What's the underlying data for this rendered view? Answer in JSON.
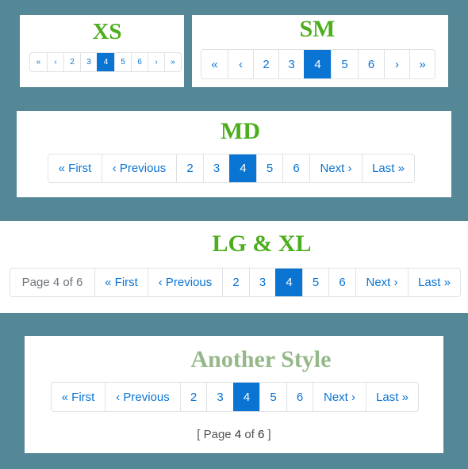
{
  "xs": {
    "heading": "XS",
    "items": [
      "«",
      "‹",
      "2",
      "3",
      "4",
      "5",
      "6",
      "›",
      "»"
    ],
    "active": 4
  },
  "sm": {
    "heading": "SM",
    "items": [
      "«",
      "‹",
      "2",
      "3",
      "4",
      "5",
      "6",
      "›",
      "»"
    ],
    "active": 4
  },
  "md": {
    "heading": "MD",
    "items": [
      "« First",
      "‹ Previous",
      "2",
      "3",
      "4",
      "5",
      "6",
      "Next ›",
      "Last »"
    ],
    "active": 4
  },
  "lg": {
    "heading": "LG & XL",
    "page_label": "Page 4 of 6",
    "items": [
      "« First",
      "‹ Previous",
      "2",
      "3",
      "4",
      "5",
      "6",
      "Next ›",
      "Last »"
    ],
    "active": 4
  },
  "another": {
    "heading": "Another Style",
    "items": [
      "« First",
      "‹ Previous",
      "2",
      "3",
      "4",
      "5",
      "6",
      "Next ›",
      "Last »"
    ],
    "active": 4,
    "summary": {
      "open": "[ Page",
      "current": "4",
      "of": "of",
      "total": "6",
      "close": "]"
    }
  },
  "colors": {
    "background": "#558896",
    "accent": "#0a74d3",
    "heading_green": "#4cae1c",
    "heading_muted": "#95b88a"
  }
}
